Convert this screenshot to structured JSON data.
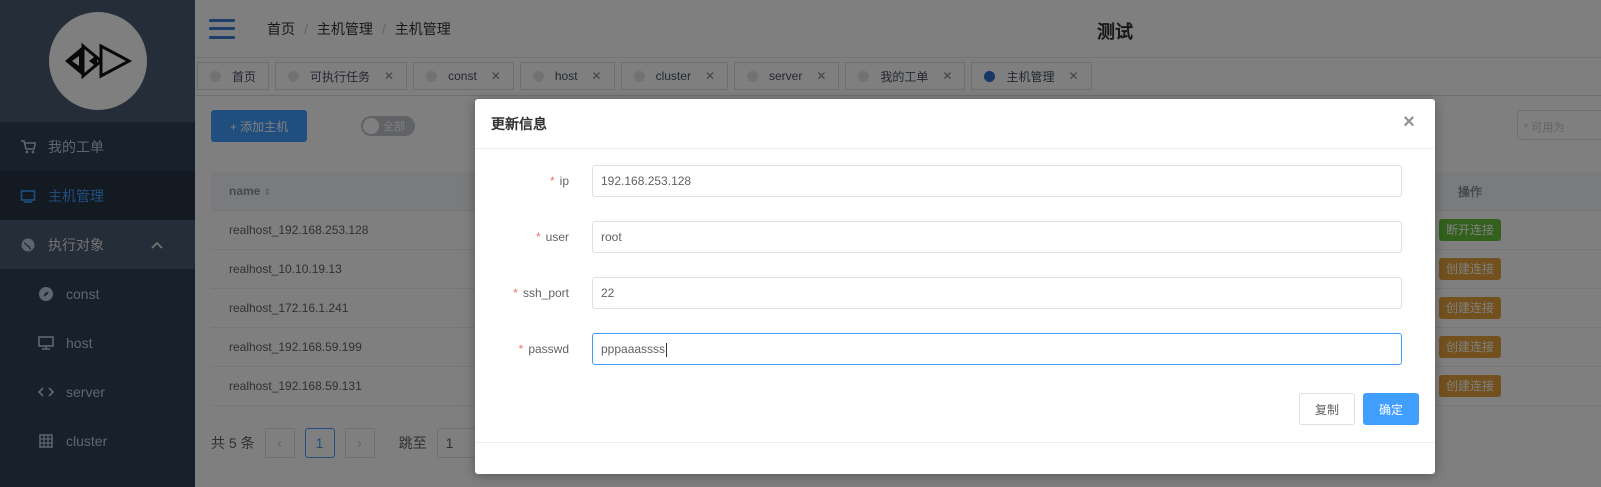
{
  "colors": {
    "primary": "#409eff",
    "sidebar_bg": "#304156",
    "success": "#67c23a",
    "warning": "#e6a23c",
    "required": "#f56c6c"
  },
  "sidebar": {
    "logo_icon": "triangle-logo-icon",
    "items": [
      {
        "label": "我的工单",
        "icon": "cart-icon"
      },
      {
        "label": "主机管理",
        "icon": "monitor-icon",
        "active": true
      },
      {
        "label": "执行对象",
        "icon": "globe-icon",
        "expanded": true
      },
      {
        "label": "const",
        "icon": "compass-icon"
      },
      {
        "label": "host",
        "icon": "desktop-icon"
      },
      {
        "label": "server",
        "icon": "code-icon"
      },
      {
        "label": "cluster",
        "icon": "grid-icon"
      }
    ]
  },
  "header": {
    "breadcrumb": [
      "首页",
      "主机管理",
      "主机管理"
    ],
    "site_title": "测试"
  },
  "tags": [
    {
      "label": "首页",
      "closable": false
    },
    {
      "label": "可执行任务",
      "closable": true
    },
    {
      "label": "const",
      "closable": true
    },
    {
      "label": "host",
      "closable": true
    },
    {
      "label": "cluster",
      "closable": true
    },
    {
      "label": "server",
      "closable": true
    },
    {
      "label": "我的工单",
      "closable": true
    },
    {
      "label": "主机管理",
      "closable": true,
      "active": true
    }
  ],
  "toolbar": {
    "add_label": "+ 添加主机",
    "switch_label": "全部",
    "search_placeholder": "* 可用为"
  },
  "table": {
    "columns": [
      "name",
      "操作"
    ],
    "rows": [
      {
        "name": "realhost_192.168.253.128",
        "action": "断开连接",
        "action_type": "green"
      },
      {
        "name": "realhost_10.10.19.13",
        "action": "创建连接",
        "action_type": "orange"
      },
      {
        "name": "realhost_172.16.1.241",
        "action": "创建连接",
        "action_type": "orange"
      },
      {
        "name": "realhost_192.168.59.199",
        "action": "创建连接",
        "action_type": "orange"
      },
      {
        "name": "realhost_192.168.59.131",
        "action": "创建连接",
        "action_type": "orange"
      }
    ]
  },
  "pagination": {
    "total_text": "共 5 条",
    "current_page": "1",
    "jump_label": "跳至",
    "jump_value": "1"
  },
  "dialog": {
    "title": "更新信息",
    "fields": [
      {
        "label": "ip",
        "value": "192.168.253.128",
        "required": true
      },
      {
        "label": "user",
        "value": "root",
        "required": true
      },
      {
        "label": "ssh_port",
        "value": "22",
        "required": true
      },
      {
        "label": "passwd",
        "value": "pppaaassss",
        "required": true,
        "focused": true
      }
    ],
    "copy_label": "复制",
    "ok_label": "确定"
  }
}
